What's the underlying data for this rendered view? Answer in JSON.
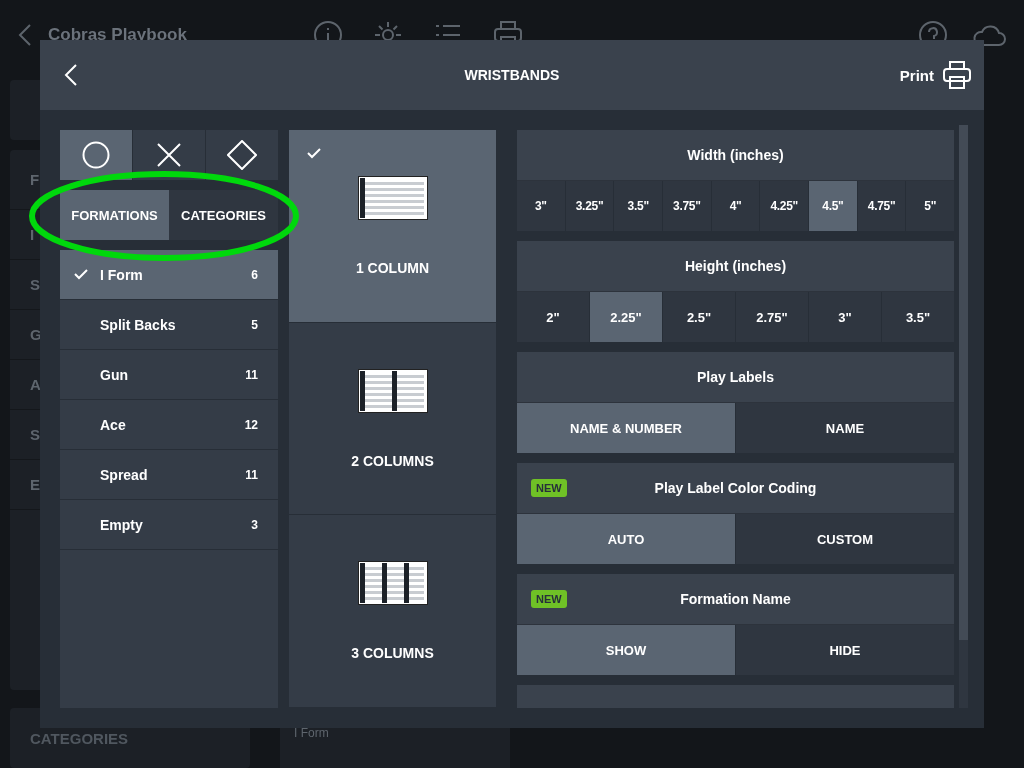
{
  "app": {
    "title": "Cobras Playbook",
    "sidebar": [
      {
        "label": "F"
      },
      {
        "label": "I"
      },
      {
        "label": "S"
      },
      {
        "label": "G"
      },
      {
        "label": "A"
      },
      {
        "label": "S"
      },
      {
        "label": "E"
      }
    ],
    "categories_label": "CATEGORIES",
    "card_subtitle": "I Form"
  },
  "dialog": {
    "title": "WRISTBANDS",
    "print_label": "Print",
    "shape_tabs": [
      {
        "kind": "circle",
        "selected": true
      },
      {
        "kind": "cross",
        "selected": false
      },
      {
        "kind": "diamond",
        "selected": false
      }
    ],
    "group_tabs": [
      {
        "label": "FORMATIONS",
        "selected": true
      },
      {
        "label": "CATEGORIES",
        "selected": false
      }
    ],
    "formations": [
      {
        "name": "I Form",
        "count": "6",
        "selected": true
      },
      {
        "name": "Split Backs",
        "count": "5",
        "selected": false
      },
      {
        "name": "Gun",
        "count": "11",
        "selected": false
      },
      {
        "name": "Ace",
        "count": "12",
        "selected": false
      },
      {
        "name": "Spread",
        "count": "11",
        "selected": false
      },
      {
        "name": "Empty",
        "count": "3",
        "selected": false
      }
    ],
    "layouts": [
      {
        "label": "1 COLUMN",
        "kind": "single",
        "selected": true
      },
      {
        "label": "2 COLUMNS",
        "kind": "double",
        "selected": false
      },
      {
        "label": "3 COLUMNS",
        "kind": "triple",
        "selected": false
      }
    ],
    "settings": [
      {
        "title": "Width (inches)",
        "new": false,
        "options": [
          {
            "label": "3\"",
            "selected": false
          },
          {
            "label": "3.25\"",
            "selected": false
          },
          {
            "label": "3.5\"",
            "selected": false
          },
          {
            "label": "3.75\"",
            "selected": false
          },
          {
            "label": "4\"",
            "selected": false
          },
          {
            "label": "4.25\"",
            "selected": false
          },
          {
            "label": "4.5\"",
            "selected": true
          },
          {
            "label": "4.75\"",
            "selected": false
          },
          {
            "label": "5\"",
            "selected": false
          }
        ]
      },
      {
        "title": "Height (inches)",
        "new": false,
        "options": [
          {
            "label": "2\"",
            "selected": false
          },
          {
            "label": "2.25\"",
            "selected": true
          },
          {
            "label": "2.5\"",
            "selected": false
          },
          {
            "label": "2.75\"",
            "selected": false
          },
          {
            "label": "3\"",
            "selected": false
          },
          {
            "label": "3.5\"",
            "selected": false
          }
        ]
      },
      {
        "title": "Play Labels",
        "new": false,
        "options": [
          {
            "label": "NAME & NUMBER",
            "selected": true
          },
          {
            "label": "NAME",
            "selected": false
          }
        ]
      },
      {
        "title": "Play Label Color Coding",
        "new": true,
        "badge": "NEW",
        "options": [
          {
            "label": "AUTO",
            "selected": true
          },
          {
            "label": "CUSTOM",
            "selected": false
          }
        ]
      },
      {
        "title": "Formation Name",
        "new": true,
        "badge": "NEW",
        "options": [
          {
            "label": "SHOW",
            "selected": true
          },
          {
            "label": "HIDE",
            "selected": false
          }
        ]
      }
    ]
  },
  "annotation": {
    "kind": "ellipse",
    "color": "#00d80c"
  }
}
